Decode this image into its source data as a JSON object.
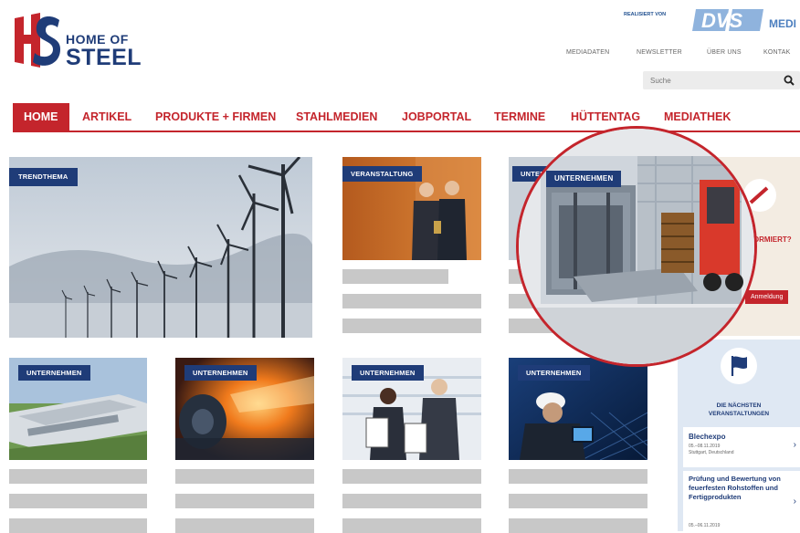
{
  "logo": {
    "line1": "HOME OF",
    "line2": "STEEL"
  },
  "partner": {
    "realisiert_label": "REALISIERT VON",
    "brand": "DVS",
    "brand_suffix": "MEDI"
  },
  "topnav": {
    "items": [
      "MEDIADATEN",
      "NEWSLETTER",
      "ÜBER UNS",
      "KONTAK"
    ]
  },
  "search": {
    "placeholder": "Suche"
  },
  "nav": {
    "items": [
      "HOME",
      "ARTIKEL",
      "PRODUKTE + FIRMEN",
      "STAHLMEDIEN",
      "JOBPORTAL",
      "TERMINE",
      "HÜTTENTAG",
      "MEDIATHEK"
    ]
  },
  "cards": {
    "c1": {
      "badge": "TRENDTHEMA"
    },
    "c2": {
      "badge": "VERANSTALTUNG"
    },
    "c3": {
      "badge": "UNTERNEHMEN"
    },
    "c4": {
      "badge": "UNTERNEHMEN"
    },
    "c5": {
      "badge": "UNTERNEHMEN"
    },
    "c6": {
      "badge": "UNTERNEHMEN"
    },
    "c7": {
      "badge": "UNTERNEHMEN"
    }
  },
  "magnifier": {
    "badge": "UNTERNEHMEN"
  },
  "promo": {
    "headline": "FORMIERT?",
    "button": "Anmeldung"
  },
  "events": {
    "heading_line1": "DIE NÄCHSTEN",
    "heading_line2": "VERANSTALTUNGEN",
    "items": [
      {
        "title": "Blechexpo",
        "meta": "05.–08.11.2019",
        "place": "Stuttgart, Deutschland"
      },
      {
        "title": "Prüfung und Bewertung von feuerfesten Rohstoffen und Fertigprodukten",
        "meta": "05.–06.11.2019",
        "place": ""
      }
    ]
  },
  "colors": {
    "brand_red": "#c4252c",
    "brand_blue": "#1f3c78",
    "placeholder_gray": "#c8c8c8"
  }
}
